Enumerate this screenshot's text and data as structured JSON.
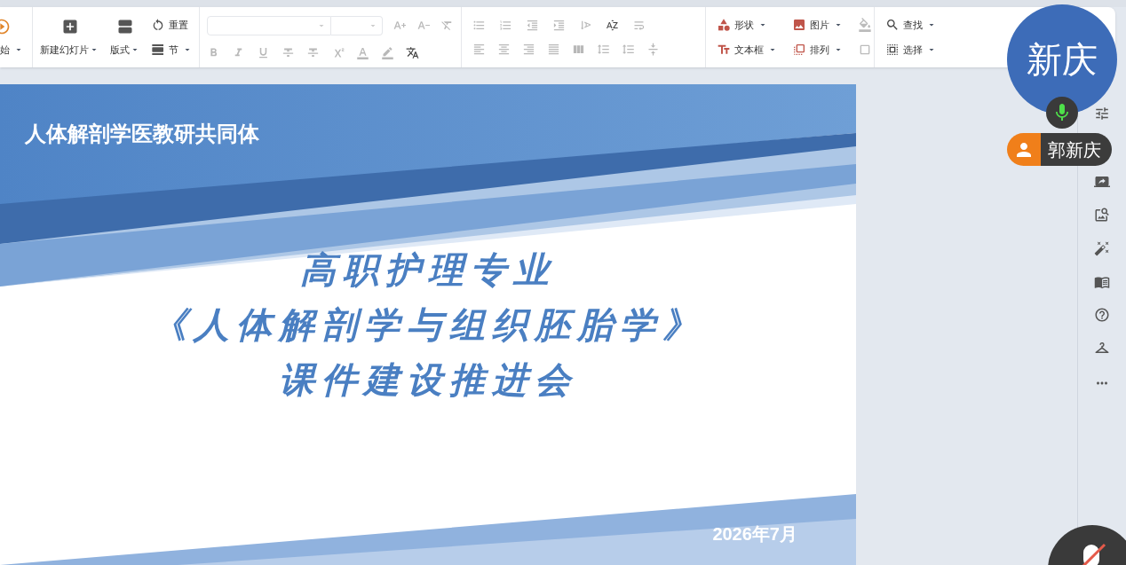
{
  "ribbon": {
    "start": {
      "label": "始"
    },
    "slides": {
      "new_slide": "新建幻灯片",
      "layout": "版式",
      "reset": "重置",
      "section": "节"
    },
    "font": {
      "disabled": true
    },
    "paragraph": {
      "disabled": true
    },
    "insert": [
      {
        "label": "形状"
      },
      {
        "label": "图片"
      },
      {
        "label": "文本框"
      },
      {
        "label": "排列"
      }
    ],
    "edit": [
      {
        "label": "查找"
      },
      {
        "label": "选择"
      }
    ]
  },
  "slide": {
    "header": "人体解剖学医教研共同体",
    "title_lines": [
      "高职护理专业",
      "《人体解剖学与组织胚胎学》",
      "课件建设推进会"
    ],
    "date": "2026年7月"
  },
  "speaker": {
    "avatar": "新庆",
    "name": "郭新庆",
    "mic_on": true
  }
}
